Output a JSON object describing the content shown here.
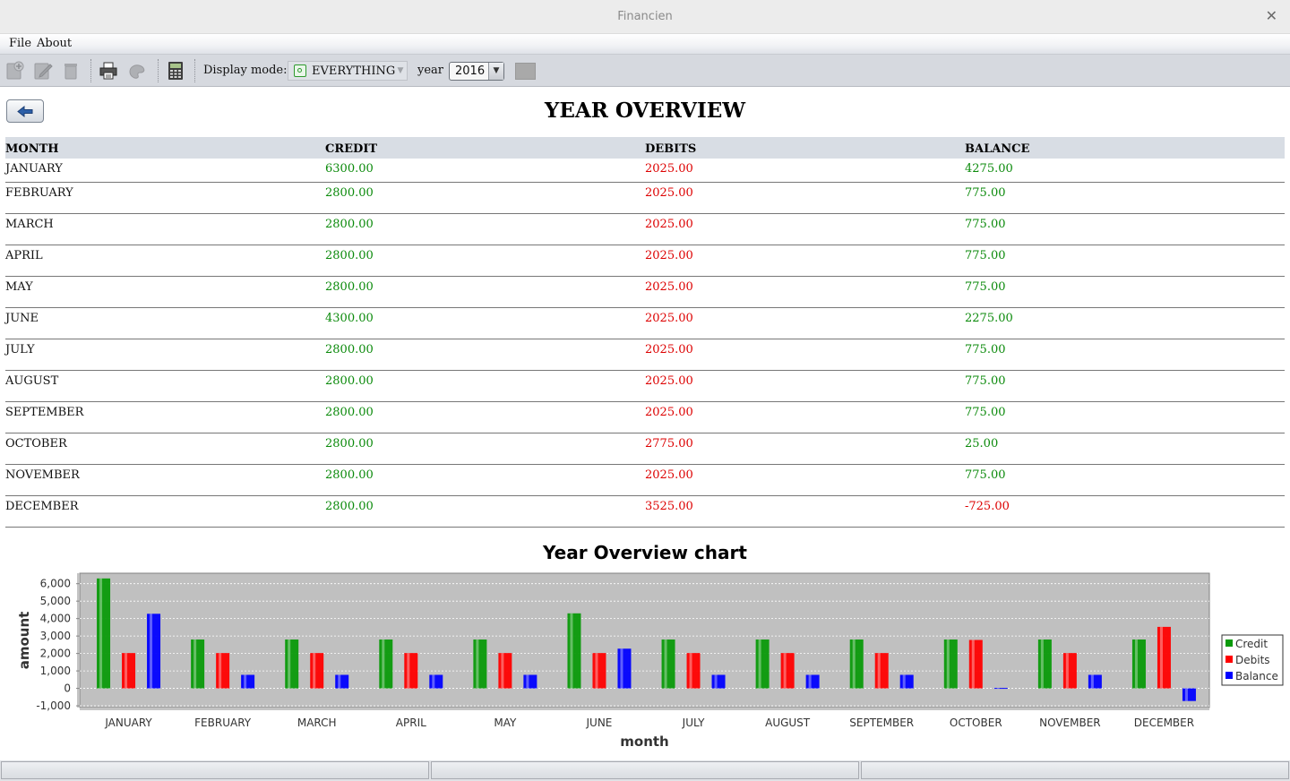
{
  "window": {
    "title": "Financien"
  },
  "menu": {
    "file": "File",
    "about": "About"
  },
  "toolbar": {
    "display_mode_label": "Display mode:",
    "display_mode_value": "EVERYTHING",
    "year_label": "year",
    "year_value": "2016"
  },
  "page": {
    "title": "YEAR OVERVIEW"
  },
  "table": {
    "headers": [
      "MONTH",
      "CREDIT",
      "DEBITS",
      "BALANCE"
    ],
    "rows": [
      {
        "month": "JANUARY",
        "credit": "6300.00",
        "debits": "2025.00",
        "balance": "4275.00"
      },
      {
        "month": "FEBRUARY",
        "credit": "2800.00",
        "debits": "2025.00",
        "balance": "775.00"
      },
      {
        "month": "MARCH",
        "credit": "2800.00",
        "debits": "2025.00",
        "balance": "775.00"
      },
      {
        "month": "APRIL",
        "credit": "2800.00",
        "debits": "2025.00",
        "balance": "775.00"
      },
      {
        "month": "MAY",
        "credit": "2800.00",
        "debits": "2025.00",
        "balance": "775.00"
      },
      {
        "month": "JUNE",
        "credit": "4300.00",
        "debits": "2025.00",
        "balance": "2275.00"
      },
      {
        "month": "JULY",
        "credit": "2800.00",
        "debits": "2025.00",
        "balance": "775.00"
      },
      {
        "month": "AUGUST",
        "credit": "2800.00",
        "debits": "2025.00",
        "balance": "775.00"
      },
      {
        "month": "SEPTEMBER",
        "credit": "2800.00",
        "debits": "2025.00",
        "balance": "775.00"
      },
      {
        "month": "OCTOBER",
        "credit": "2800.00",
        "debits": "2775.00",
        "balance": "25.00"
      },
      {
        "month": "NOVEMBER",
        "credit": "2800.00",
        "debits": "2025.00",
        "balance": "775.00"
      },
      {
        "month": "DECEMBER",
        "credit": "2800.00",
        "debits": "3525.00",
        "balance": "-725.00"
      }
    ]
  },
  "colors": {
    "credit": "#0a9a0a",
    "debits": "#ff0000",
    "balance": "#0000ff",
    "positive_text": "#0b8a0b",
    "negative_text": "#dd0000",
    "plot_bg": "#c0c0c0"
  },
  "chart_data": {
    "type": "bar",
    "title": "Year Overview chart",
    "xlabel": "month",
    "ylabel": "amount",
    "categories": [
      "JANUARY",
      "FEBRUARY",
      "MARCH",
      "APRIL",
      "MAY",
      "JUNE",
      "JULY",
      "AUGUST",
      "SEPTEMBER",
      "OCTOBER",
      "NOVEMBER",
      "DECEMBER"
    ],
    "series": [
      {
        "name": "Credit",
        "values": [
          6300,
          2800,
          2800,
          2800,
          2800,
          4300,
          2800,
          2800,
          2800,
          2800,
          2800,
          2800
        ]
      },
      {
        "name": "Debits",
        "values": [
          2025,
          2025,
          2025,
          2025,
          2025,
          2025,
          2025,
          2025,
          2025,
          2775,
          2025,
          3525
        ]
      },
      {
        "name": "Balance",
        "values": [
          4275,
          775,
          775,
          775,
          775,
          2275,
          775,
          775,
          775,
          25,
          775,
          -725
        ]
      }
    ],
    "ylim": [
      -1100,
      6600
    ],
    "yticks": [
      -1000,
      0,
      1000,
      2000,
      3000,
      4000,
      5000,
      6000
    ],
    "ytick_labels": [
      "-1,000",
      "0",
      "1,000",
      "2,000",
      "3,000",
      "4,000",
      "5,000",
      "6,000"
    ],
    "grid": true,
    "legend_position": "right"
  }
}
